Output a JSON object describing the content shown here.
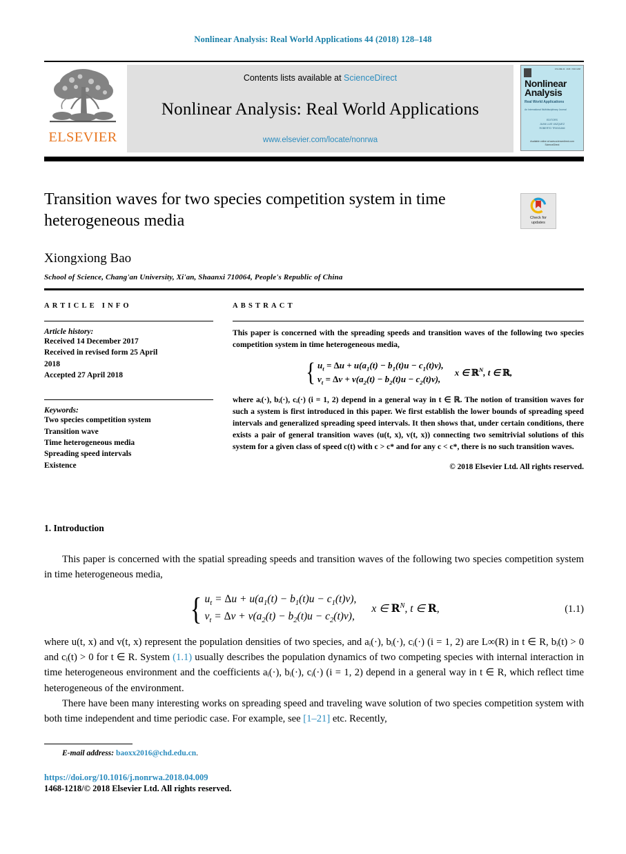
{
  "running_head": "Nonlinear Analysis: Real World Applications 44 (2018) 128–148",
  "header": {
    "publisher_name": "ELSEVIER",
    "contents_prefix": "Contents lists available at ",
    "contents_link": "ScienceDirect",
    "journal_title": "Nonlinear Analysis: Real World Applications",
    "journal_url": "www.elsevier.com/locate/nonrwa",
    "cover": {
      "title_line1": "Nonlinear",
      "title_line2": "Analysis",
      "subtitle": "Real World Applications",
      "subtitle2": "An International Multidisciplinary Journal",
      "editors_label": "EDITORS",
      "editor1": "JUAN LUIS VAZQUEZ",
      "editor2": "ROBERTO TRIGGIANI",
      "foot1": "Available online at www.sciencedirect.com",
      "foot2": "ScienceDirect"
    }
  },
  "article": {
    "title": "Transition waves for two species competition system in time heterogeneous media",
    "crossmark_line1": "Check for",
    "crossmark_line2": "updates",
    "author": "Xiongxiong Bao",
    "affiliation": "School of Science, Chang'an University, Xi'an, Shaanxi 710064, People's Republic of China"
  },
  "article_info": {
    "heading": "ARTICLE INFO",
    "history_label": "Article history:",
    "history": [
      "Received 14 December 2017",
      "Received in revised form 25 April",
      "2018",
      "Accepted 27 April 2018"
    ],
    "keywords_label": "Keywords:",
    "keywords": [
      "Two species competition system",
      "Transition wave",
      "Time heterogeneous media",
      "Spreading speed intervals",
      "Existence"
    ]
  },
  "abstract": {
    "heading": "ABSTRACT",
    "para1": "This paper is concerned with the spreading speeds and transition waves of the following two species competition system in time heterogeneous media,",
    "equation": {
      "line1": "u_t = Δu + u(a₁(t) − b₁(t)u − c₁(t)v),",
      "line2": "v_t = Δv + v(a₂(t) − b₂(t)u − c₂(t)v),",
      "condition": "x ∈ ℝ^N, t ∈ ℝ,"
    },
    "para2": "where aᵢ(·), bᵢ(·), cᵢ(·) (i = 1, 2) depend in a general way in t ∈ ℝ. The notion of transition waves for such a system is first introduced in this paper. We first establish the lower bounds of spreading speed intervals and generalized spreading speed intervals. It then shows that, under certain conditions, there exists a pair of general transition waves (u(t, x), v(t, x)) connecting two semitrivial solutions of this system for a given class of speed c(t) with c > c* and for any c < c*, there is no such transition waves.",
    "copyright": "© 2018 Elsevier Ltd. All rights reserved."
  },
  "body": {
    "section_heading": "1. Introduction",
    "para1": "This paper is concerned with the spatial spreading speeds and transition waves of the following two species competition system in time heterogeneous media,",
    "equation": {
      "line1": "u_t = Δu + u(a₁(t) − b₁(t)u − c₁(t)v),",
      "line2": "v_t = Δv + v(a₂(t) − b₂(t)u − c₂(t)v),",
      "condition": "x ∈ R^N, t ∈ R,",
      "number": "(1.1)"
    },
    "para2_a": "where u(t, x) and v(t, x) represent the population densities of two species, and aᵢ(·), bᵢ(·), cᵢ(·) (i = 1, 2) are L∞(R) in t ∈ R, bᵢ(t) > 0 and cᵢ(t) > 0 for t ∈ R. System ",
    "para2_link": "(1.1)",
    "para2_b": " usually describes the population dynamics of two competing species with internal interaction in time heterogeneous environment and the coefficients aᵢ(·), bᵢ(·), cᵢ(·) (i = 1, 2) depend in a general way in t ∈ R, which reflect time heterogeneous of the environment.",
    "para3_a": "There have been many interesting works on spreading speed and traveling wave solution of two species competition system with both time independent and time periodic case. For example, see ",
    "para3_link": "[1–21]",
    "para3_b": " etc. Recently,"
  },
  "footer": {
    "email_label": "E-mail address:",
    "email": "baoxx2016@chd.edu.cn",
    "email_period": ".",
    "doi": "https://doi.org/10.1016/j.nonrwa.2018.04.009",
    "issn_line": "1468-1218/© 2018 Elsevier Ltd. All rights reserved."
  },
  "colors": {
    "link": "#2b8cbe",
    "running_head": "#1a7fa8",
    "elsevier_orange": "#E87722",
    "panel_gray": "#e0e0e0",
    "cover_blue": "#bfe4ee"
  }
}
